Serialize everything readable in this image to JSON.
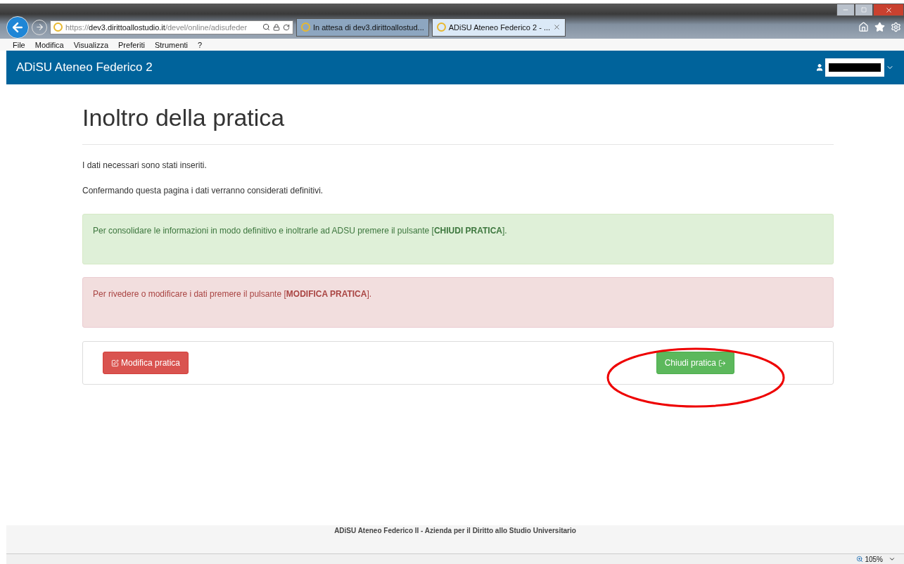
{
  "browser": {
    "url": {
      "scheme": "https://",
      "host": "dev3.dirittoallostudio.it",
      "path": "/devel/online/adisufeder"
    },
    "tabs": [
      {
        "label": "In attesa di dev3.dirittoallostud...",
        "selected": false
      },
      {
        "label": "ADiSU Ateneo Federico 2 - ...",
        "selected": true
      }
    ],
    "menu": [
      "File",
      "Modifica",
      "Visualizza",
      "Preferiti",
      "Strumenti",
      "?"
    ]
  },
  "navbar": {
    "brand": "ADiSU Ateneo Federico 2"
  },
  "page": {
    "title": "Inoltro della pratica",
    "paragraphs": [
      "I dati necessari sono stati inseriti.",
      "Confermando questa pagina i dati verranno considerati definitivi."
    ],
    "alerts": [
      {
        "kind": "success",
        "text": "Per consolidare le informazioni in modo definitivo e inoltrarle ad ADSU premere il pulsante [**CHIUDI PRATICA**]."
      },
      {
        "kind": "danger",
        "text": "Per rivedere o modificare i dati premere il pulsante [**MODIFICA PRATICA**]."
      }
    ],
    "buttons": [
      {
        "kind": "danger",
        "label": "Modifica pratica"
      },
      {
        "kind": "success",
        "label": "Chiudi pratica"
      }
    ]
  },
  "footer": "ADiSU Ateneo Federico II - Azienda per il Diritto allo Studio Universitario",
  "status_bar": {
    "zoom": "105%"
  }
}
